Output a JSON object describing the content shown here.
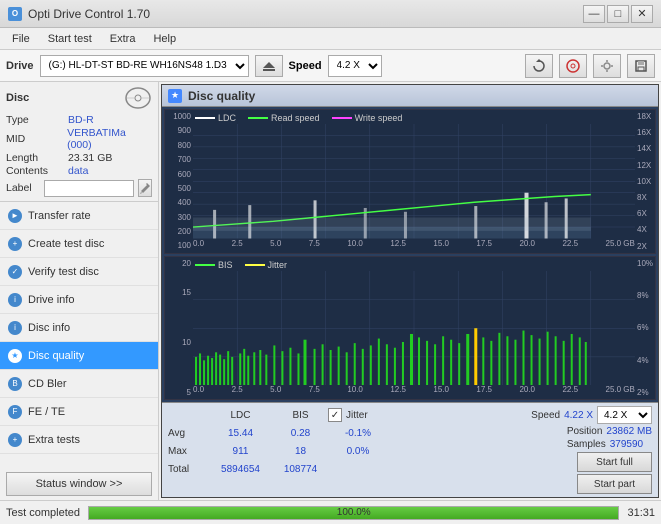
{
  "titlebar": {
    "title": "Opti Drive Control 1.70",
    "minimize": "—",
    "maximize": "□",
    "close": "✕"
  },
  "menu": {
    "items": [
      "File",
      "Start test",
      "Extra",
      "Help"
    ]
  },
  "toolbar": {
    "drive_label": "Drive",
    "drive_value": "(G:) HL-DT-ST BD-RE  WH16NS48 1.D3",
    "speed_label": "Speed",
    "speed_value": "4.2 X"
  },
  "disc_info": {
    "title": "Disc",
    "type_label": "Type",
    "type_value": "BD-R",
    "mid_label": "MID",
    "mid_value": "VERBATIMa (000)",
    "length_label": "Length",
    "length_value": "23.31 GB",
    "contents_label": "Contents",
    "contents_value": "data",
    "label_label": "Label"
  },
  "nav_items": [
    {
      "id": "transfer-rate",
      "label": "Transfer rate",
      "active": false
    },
    {
      "id": "create-test-disc",
      "label": "Create test disc",
      "active": false
    },
    {
      "id": "verify-test-disc",
      "label": "Verify test disc",
      "active": false
    },
    {
      "id": "drive-info",
      "label": "Drive info",
      "active": false
    },
    {
      "id": "disc-info",
      "label": "Disc info",
      "active": false
    },
    {
      "id": "disc-quality",
      "label": "Disc quality",
      "active": true
    },
    {
      "id": "cd-bler",
      "label": "CD Bler",
      "active": false
    },
    {
      "id": "fe-te",
      "label": "FE / TE",
      "active": false
    },
    {
      "id": "extra-tests",
      "label": "Extra tests",
      "active": false
    }
  ],
  "status_window_btn": "Status window >>",
  "quality_panel": {
    "title": "Disc quality",
    "legend": {
      "ldc": "LDC",
      "read": "Read speed",
      "write": "Write speed"
    },
    "legend2": {
      "bis": "BIS",
      "jitter": "Jitter"
    },
    "chart1_y_left": [
      "1000",
      "900",
      "800",
      "700",
      "600",
      "500",
      "400",
      "300",
      "200",
      "100"
    ],
    "chart1_y_right": [
      "18X",
      "16X",
      "14X",
      "12X",
      "10X",
      "8X",
      "6X",
      "4X",
      "2X"
    ],
    "chart2_y_left": [
      "20",
      "15",
      "10",
      "5"
    ],
    "chart2_y_right": [
      "10%",
      "8%",
      "6%",
      "4%",
      "2%"
    ],
    "x_labels": [
      "0.0",
      "2.5",
      "5.0",
      "7.5",
      "10.0",
      "12.5",
      "15.0",
      "17.5",
      "20.0",
      "22.5",
      "25.0 GB"
    ]
  },
  "stats": {
    "headers": {
      "ldc": "LDC",
      "bis": "BIS",
      "jitter_label": "Jitter",
      "speed_label": "Speed",
      "speed_value": "4.22 X"
    },
    "avg_label": "Avg",
    "avg_ldc": "15.44",
    "avg_bis": "0.28",
    "avg_jitter": "-0.1%",
    "max_label": "Max",
    "max_ldc": "911",
    "max_bis": "18",
    "max_jitter": "0.0%",
    "total_label": "Total",
    "total_ldc": "5894654",
    "total_bis": "108774",
    "position_label": "Position",
    "position_value": "23862 MB",
    "samples_label": "Samples",
    "samples_value": "379590",
    "speed_select": "4.2 X",
    "start_full": "Start full",
    "start_part": "Start part"
  },
  "statusbar": {
    "text": "Test completed",
    "progress": 100,
    "progress_text": "100.0%",
    "time": "31:31"
  }
}
